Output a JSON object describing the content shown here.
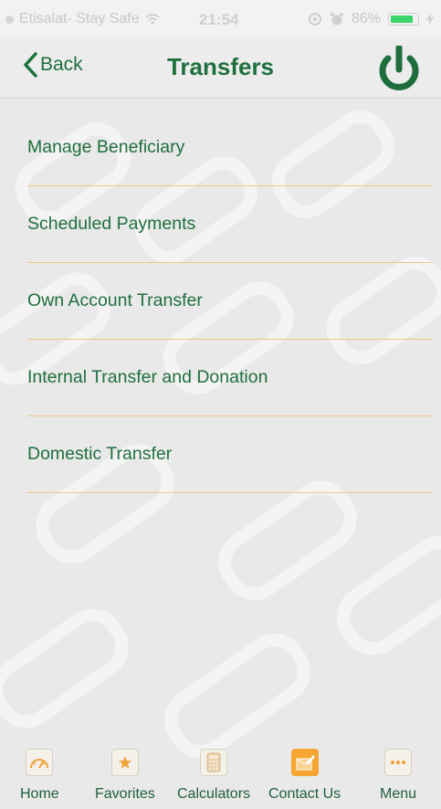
{
  "status_bar": {
    "carrier": "Etisalat- Stay Safe",
    "time": "21:54",
    "battery": "86%"
  },
  "header": {
    "back_label": "Back",
    "title": "Transfers"
  },
  "menu": {
    "items": [
      {
        "label": "Manage Beneficiary"
      },
      {
        "label": "Scheduled Payments"
      },
      {
        "label": "Own Account Transfer"
      },
      {
        "label": "Internal Transfer and Donation"
      },
      {
        "label": "Domestic Transfer"
      }
    ]
  },
  "tabbar": {
    "tabs": [
      {
        "label": "Home",
        "icon": "speedometer-icon"
      },
      {
        "label": "Favorites",
        "icon": "star-icon"
      },
      {
        "label": "Calculators",
        "icon": "calculator-icon"
      },
      {
        "label": "Contact Us",
        "icon": "envelope-edit-icon"
      },
      {
        "label": "Menu",
        "icon": "more-dots-icon"
      }
    ]
  },
  "colors": {
    "brand_green": "#1f6f3e",
    "divider_orange": "#f0c58a",
    "icon_orange": "#f2a23a"
  }
}
